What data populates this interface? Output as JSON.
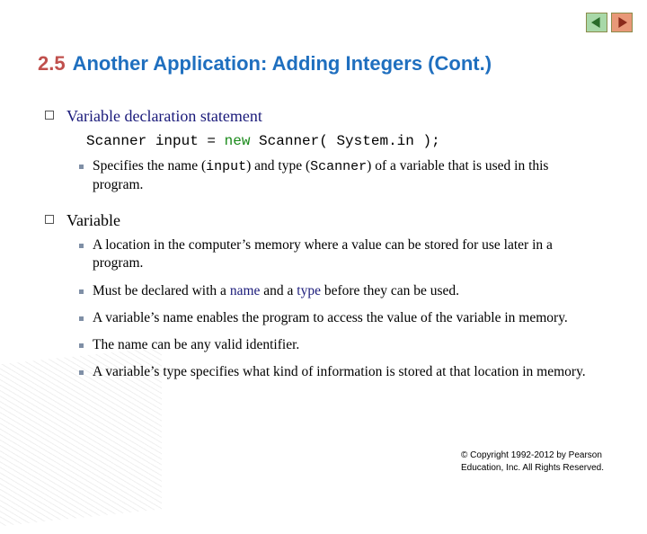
{
  "title": {
    "number": "2.5",
    "text": "Another Application: Adding Integers (Cont.)"
  },
  "section1": {
    "heading": "Variable declaration statement",
    "code": {
      "pre": "Scanner input = ",
      "kw": "new",
      "post": " Scanner( System.in );"
    },
    "items": [
      {
        "p1": "Specifies the name (",
        "c1": "input",
        "p2": ") and type (",
        "c2": "Scanner",
        "p3": ") of a variable that is used in this program."
      }
    ]
  },
  "section2": {
    "heading": "Variable",
    "items": [
      {
        "text": "A location in the computer’s memory where a value can be stored for use later in a program."
      },
      {
        "p1": "Must be declared with a ",
        "b1": "name",
        "p2": " and a ",
        "b2": "type",
        "p3": " before they can be used."
      },
      {
        "text": "A variable’s name enables the program to access the value of the variable in memory."
      },
      {
        "text": "The name can be any valid identifier."
      },
      {
        "text": "A variable’s type specifies what kind of information is stored at that location in memory."
      }
    ]
  },
  "footer": {
    "line1": "© Copyright 1992-2012 by Pearson",
    "line2": "Education, Inc. All Rights Reserved."
  }
}
